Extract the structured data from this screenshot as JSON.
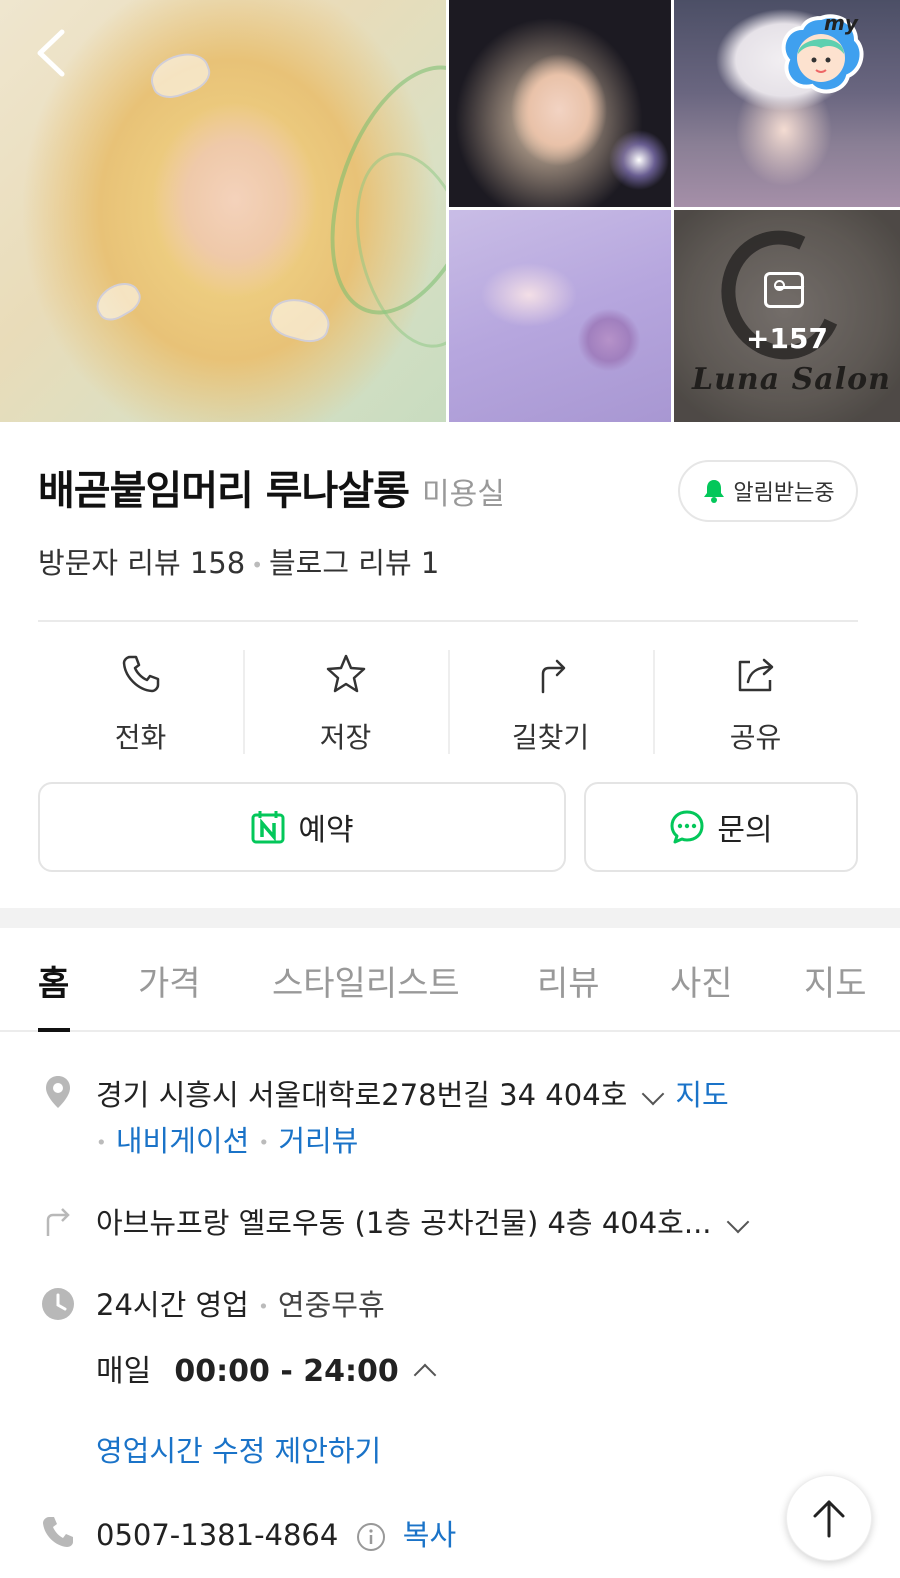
{
  "gallery": {
    "more_count": "+157",
    "salon_sign_text": "Luna Salon",
    "badge_text": "my"
  },
  "place": {
    "name": "배곧붙임머리 루나살롱",
    "category": "미용실",
    "notify_label": "알림받는중",
    "visitor_reviews": "방문자 리뷰 158",
    "blog_reviews": "블로그 리뷰 1"
  },
  "actions": [
    {
      "label": "전화",
      "icon": "phone-icon"
    },
    {
      "label": "저장",
      "icon": "star-icon"
    },
    {
      "label": "길찾기",
      "icon": "directions-icon"
    },
    {
      "label": "공유",
      "icon": "share-icon"
    }
  ],
  "buttons": {
    "reserve_label": "예약",
    "inquiry_label": "문의"
  },
  "tabs": [
    "홈",
    "가격",
    "스타일리스트",
    "리뷰",
    "사진",
    "지도"
  ],
  "info": {
    "address": "경기 시흥시 서울대학로278번길 34 404호",
    "map_link": "지도",
    "navigation_link": "내비게이션",
    "streetview_link": "거리뷰",
    "directions_text": "아브뉴프랑 옐로우동 (1층 공차건물) 4층 404호...",
    "hours_status": "24시간 영업",
    "hours_note": "연중무휴",
    "hours_day": "매일",
    "hours_time": "00:00 - 24:00",
    "suggest_link": "영업시간 수정 제안하기",
    "phone": "0507-1381-4864",
    "copy_link": "복사"
  },
  "colors": {
    "accent_green": "#03c75a",
    "link_blue": "#1a73c8"
  }
}
